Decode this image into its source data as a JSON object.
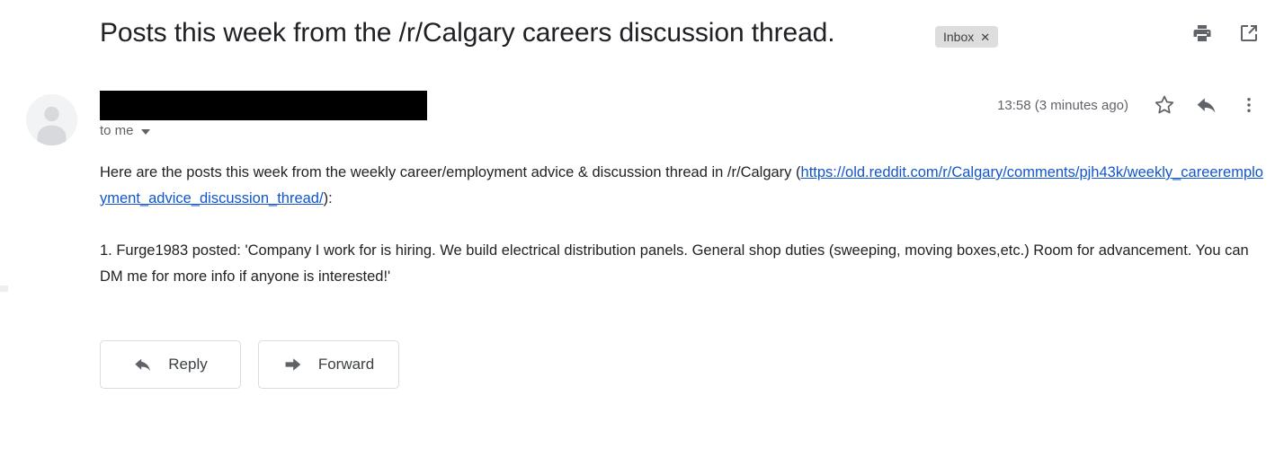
{
  "email": {
    "subject": "Posts this week from the /r/Calgary careers discussion thread.",
    "label": {
      "name": "Inbox",
      "remove_glyph": "✕"
    },
    "header_actions": [
      {
        "name": "print-icon",
        "tooltip": "Print all"
      },
      {
        "name": "open-in-new-window-icon",
        "tooltip": "Open in new window"
      }
    ],
    "sender": {
      "name_redacted": true,
      "recipients": "to me"
    },
    "timestamp": "13:58 (3 minutes ago)",
    "meta_actions": [
      {
        "name": "star-icon",
        "tooltip": "Not starred"
      },
      {
        "name": "reply-icon",
        "tooltip": "Reply"
      },
      {
        "name": "more-options-icon",
        "tooltip": "More"
      }
    ],
    "body": {
      "paragraph_1_before_link": "Here are the posts this week from the weekly career/employment advice & discussion thread in /r/Calgary (",
      "link_text": "https://old.reddit.com/r/Calgary/comments/pjh43k/weekly_careeremployment_advice_discussion_thread/",
      "link_href": "https://old.reddit.com/r/Calgary/comments/pjh43k/weekly_careeremployment_advice_discussion_thread/",
      "paragraph_1_after_link": "):",
      "paragraph_2": "1. Furge1983 posted: 'Company I work for is hiring. We build electrical distribution panels. General shop duties (sweeping, moving boxes,etc.) Room for advancement. You can DM me for more info if anyone is interested!'"
    },
    "footer_buttons": {
      "reply_label": "Reply",
      "forward_label": "Forward"
    },
    "colors": {
      "link": "#1155cc",
      "text": "#222222",
      "muted": "#5f6368",
      "chip_bg": "#ddddde",
      "border": "#dadce0"
    }
  }
}
